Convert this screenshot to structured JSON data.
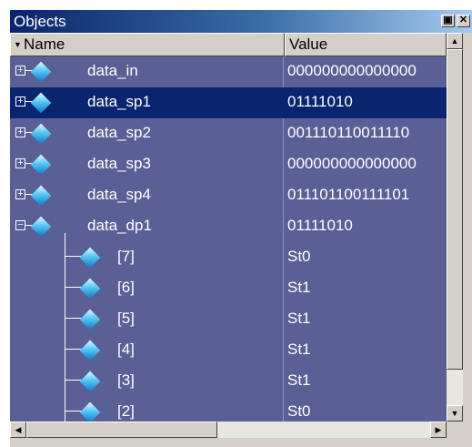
{
  "window": {
    "title": "Objects",
    "float_icon": "undock-icon",
    "close_icon": "close-icon"
  },
  "columns": {
    "name": "Name",
    "value": "Value"
  },
  "rows": [
    {
      "name": "data_in",
      "value": "000000000000000",
      "expanded": false,
      "selected": false
    },
    {
      "name": "data_sp1",
      "value": "01111010",
      "expanded": false,
      "selected": true
    },
    {
      "name": "data_sp2",
      "value": "001110110011110",
      "expanded": false,
      "selected": false
    },
    {
      "name": "data_sp3",
      "value": "000000000000000",
      "expanded": false,
      "selected": false
    },
    {
      "name": "data_sp4",
      "value": "011101100111101",
      "expanded": false,
      "selected": false
    },
    {
      "name": "data_dp1",
      "value": "01111010",
      "expanded": true,
      "selected": false
    }
  ],
  "children": [
    {
      "name": "[7]",
      "value": "St0"
    },
    {
      "name": "[6]",
      "value": "St1"
    },
    {
      "name": "[5]",
      "value": "St1"
    },
    {
      "name": "[4]",
      "value": "St1"
    },
    {
      "name": "[3]",
      "value": "St1"
    },
    {
      "name": "[2]",
      "value": "St0"
    }
  ],
  "colors": {
    "background": "#5a5f95",
    "selected_row": "#0b2470",
    "titlebar_start": "#0a246a",
    "titlebar_end": "#a6caf0"
  }
}
